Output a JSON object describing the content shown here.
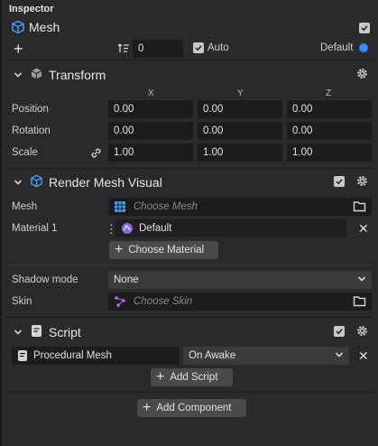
{
  "panel": {
    "title": "Inspector"
  },
  "object": {
    "name": "Mesh",
    "layer_value": "0",
    "auto_label": "Auto",
    "default_label": "Default"
  },
  "transform": {
    "title": "Transform",
    "axes": [
      "X",
      "Y",
      "Z"
    ],
    "position_label": "Position",
    "rotation_label": "Rotation",
    "scale_label": "Scale",
    "position": [
      "0.00",
      "0.00",
      "0.00"
    ],
    "rotation": [
      "0.00",
      "0.00",
      "0.00"
    ],
    "scale": [
      "1.00",
      "1.00",
      "1.00"
    ]
  },
  "render_mesh": {
    "title": "Render Mesh Visual",
    "mesh_label": "Mesh",
    "mesh_placeholder": "Choose Mesh",
    "material_label": "Material 1",
    "material_value": "Default",
    "choose_material": "Choose Material",
    "shadow_label": "Shadow mode",
    "shadow_value": "None",
    "skin_label": "Skin",
    "skin_placeholder": "Choose Skin"
  },
  "script": {
    "title": "Script",
    "script_name": "Procedural Mesh",
    "event_value": "On Awake",
    "add_script": "Add Script"
  },
  "add_component": "Add Component",
  "colors": {
    "accent": "#2f8cff",
    "bg": "#2a2a2c",
    "field": "#1c1c1e",
    "button": "#4a4a4d"
  }
}
